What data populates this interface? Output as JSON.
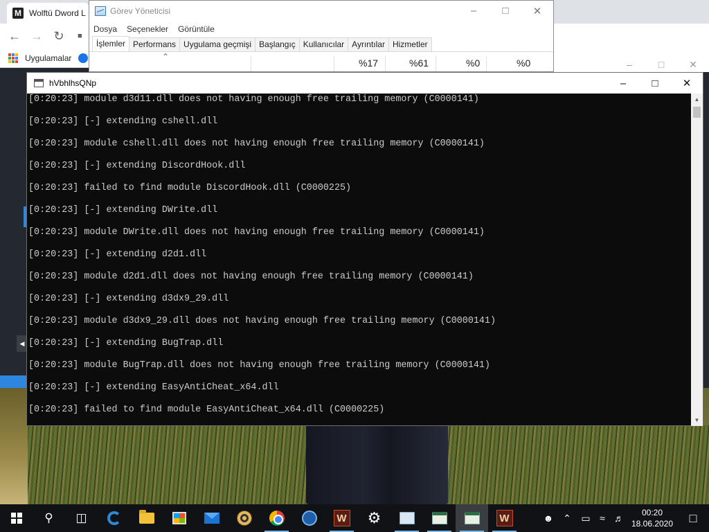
{
  "browser": {
    "tab_title": "Wolftü Dword L",
    "tab_favicon_letter": "M",
    "bookmarks_label": "Uygulamalar"
  },
  "task_manager": {
    "title": "Görev Yöneticisi",
    "menu": [
      "Dosya",
      "Seçenekler",
      "Görüntüle"
    ],
    "tabs": [
      "İşlemler",
      "Performans",
      "Uygulama geçmişi",
      "Başlangıç",
      "Kullanıcılar",
      "Ayrıntılar",
      "Hizmetler"
    ],
    "active_tab": "İşlemler",
    "usage": [
      "%17",
      "%61",
      "%0",
      "%0"
    ]
  },
  "console": {
    "title": "hVbhlhsQNp",
    "lines": [
      "[0:20:23] module d3d11.dll does not having enough free trailing memory (C0000141)",
      "[0:20:23] [-] extending cshell.dll",
      "[0:20:23] module cshell.dll does not having enough free trailing memory (C0000141)",
      "[0:20:23] [-] extending DiscordHook.dll",
      "[0:20:23] failed to find module DiscordHook.dll (C0000225)",
      "[0:20:23] [-] extending DWrite.dll",
      "[0:20:23] module DWrite.dll does not having enough free trailing memory (C0000141)",
      "[0:20:23] [-] extending d2d1.dll",
      "[0:20:23] module d2d1.dll does not having enough free trailing memory (C0000141)",
      "[0:20:23] [-] extending d3dx9_29.dll",
      "[0:20:23] module d3dx9_29.dll does not having enough free trailing memory (C0000141)",
      "[0:20:23] [-] extending BugTrap.dll",
      "[0:20:23] module BugTrap.dll does not having enough free trailing memory (C0000141)",
      "[0:20:23] [-] extending EasyAntiCheat_x64.dll",
      "[0:20:23] failed to find module EasyAntiCheat_x64.dll (C0000225)"
    ]
  },
  "taskbar": {
    "wolf_letter": "W",
    "time": "00:20",
    "date": "18.06.2020"
  },
  "colors": {
    "console_bg": "#0c0c0c",
    "console_text": "#cccccc",
    "taskbar_bg": "#101216",
    "accent": "#76b9ed"
  }
}
